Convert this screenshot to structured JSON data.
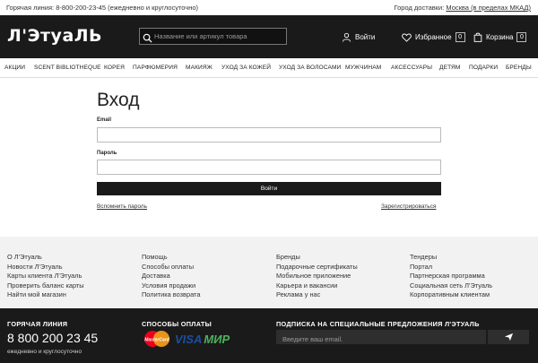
{
  "topbar": {
    "hotline": "Горячая линия: 8-800-200-23-45 (ежедневно и круглосуточно)",
    "city_label": "Город доставки:",
    "city_value": "Москва (в пределах МКАД)"
  },
  "header": {
    "logo": "Л'ЭтуаЛЬ",
    "search_placeholder": "Название или артикул товара",
    "login_label": "Войти",
    "favorites_label": "Избранное",
    "favorites_count": "0",
    "cart_label": "Корзина",
    "cart_count": "0"
  },
  "nav": {
    "items": [
      "АКЦИИ",
      "SCENT BIBLIOTHEQUE",
      "КОРЕЯ",
      "ПАРФЮМЕРИЯ",
      "МАКИЯЖ",
      "УХОД ЗА КОЖЕЙ",
      "УХОД ЗА ВОЛОСАМИ",
      "МУЖЧИНАМ",
      "АКСЕССУАРЫ",
      "ДЕТЯМ",
      "ПОДАРКИ",
      "БРЕНДЫ"
    ]
  },
  "login": {
    "title": "Вход",
    "email_label": "Email",
    "email_value": "",
    "password_label": "Пароль",
    "password_value": "",
    "submit_label": "Войти",
    "forgot_label": "Вспомнить пароль",
    "register_label": "Зарегистрироваться"
  },
  "footer": {
    "col1": [
      "О Л'Этуаль",
      "Новости Л'Этуаль",
      "Карты клиента Л'Этуаль",
      "Проверить баланс карты",
      "Найти мой магазин"
    ],
    "col2": [
      "Помощь",
      "Способы оплаты",
      "Доставка",
      "Условия продажи",
      "Политика возврата"
    ],
    "col3": [
      "Бренды",
      "Подарочные сертификаты",
      "Мобильное приложение",
      "Карьера и вакансии",
      "Реклама у нас"
    ],
    "col4": [
      "Тендеры",
      "Портал",
      "Партнерская программа",
      "Социальная сеть Л'Этуаль",
      "Корпоративным клиентам"
    ],
    "hotline_heading": "ГОРЯЧАЯ ЛИНИЯ",
    "phone": "8 800 200 23 45",
    "phone_sub": "ежедневно и круглосуточно",
    "payment_heading": "СПОСОБЫ ОПЛАТЫ",
    "mastercard": "MasterCard",
    "visa": "VISA",
    "mir": "МИР",
    "subscribe_heading": "ПОДПИСКА НА СПЕЦИАЛЬНЫЕ ПРЕДЛОЖЕНИЯ Л'ЭТУАЛЬ",
    "subscribe_placeholder": "Введите ваш email."
  },
  "colors": {
    "dark": "#1a1a1a",
    "footer_bg": "#f2f2f2",
    "mastercard_red": "#eb001b",
    "mastercard_orange": "#f79e1b",
    "visa_blue": "#1a4fa0",
    "mir_green": "#4db45e"
  }
}
